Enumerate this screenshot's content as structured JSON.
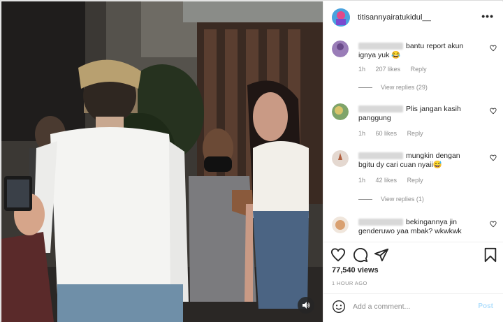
{
  "post": {
    "username": "titisannyairatukidul__",
    "more_label": "•••",
    "views": "77,540 views",
    "timestamp": "1 HOUR AGO",
    "comment_placeholder": "Add a comment...",
    "post_label": "Post"
  },
  "comments": [
    {
      "text": "bantu report akun ignya yuk 😂",
      "time": "1h",
      "likes": "207 likes",
      "reply": "Reply",
      "view_replies": "View replies (29)"
    },
    {
      "text": "Plis jangan kasih panggung",
      "time": "1h",
      "likes": "60 likes",
      "reply": "Reply",
      "view_replies": ""
    },
    {
      "text": "mungkin dengan bgitu dy cari cuan nyaii😅",
      "time": "1h",
      "likes": "42 likes",
      "reply": "Reply",
      "view_replies": "View replies (1)"
    },
    {
      "text": "bekingannya jin genderuwo yaa mbak? wkwkwk",
      "time": "",
      "likes": "",
      "reply": "",
      "view_replies": ""
    }
  ],
  "icons": {
    "like": "heart-icon",
    "comment": "comment-icon",
    "share": "paper-plane-icon",
    "save": "bookmark-icon",
    "emoji": "smiley-icon",
    "sound": "speaker-icon",
    "more": "ellipsis-icon"
  },
  "colors": {
    "text": "#262626",
    "secondary": "#8e8e8e",
    "post_disabled": "#b2dffc",
    "border": "#dbdbdb"
  }
}
